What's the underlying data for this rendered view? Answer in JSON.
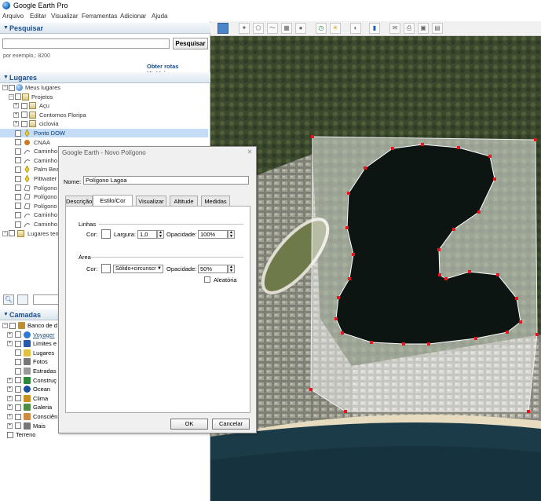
{
  "app": {
    "title": "Google Earth Pro"
  },
  "menu": [
    "Arquivo",
    "Editar",
    "Visualizar",
    "Ferramentas",
    "Adicionar",
    "Ajuda"
  ],
  "search": {
    "header": "Pesquisar",
    "input_value": "",
    "button": "Pesquisar",
    "hint": "por exemplo,: 8200",
    "links": [
      "Obter rotas",
      "Histórico"
    ]
  },
  "places": {
    "header": "Lugares",
    "items": [
      {
        "label": "Meus lugares"
      },
      {
        "label": "Projetos"
      },
      {
        "label": "Açu"
      },
      {
        "label": "Contornos Floripa"
      },
      {
        "label": "ciclovia"
      },
      {
        "label": "Ponto DOW"
      },
      {
        "label": "CNAA"
      },
      {
        "label": "Caminho"
      },
      {
        "label": "Caminho"
      },
      {
        "label": "Palm Bea"
      },
      {
        "label": "Pittwater"
      },
      {
        "label": "Polígono"
      },
      {
        "label": "Polígono"
      },
      {
        "label": "Polígono"
      },
      {
        "label": "Caminho"
      },
      {
        "label": "Caminho"
      },
      {
        "label": "Lugares ten"
      }
    ]
  },
  "layers": {
    "header": "Camadas",
    "items": [
      {
        "label": "Banco de d"
      },
      {
        "label": "Voyager"
      },
      {
        "label": "Limites e"
      },
      {
        "label": "Lugares"
      },
      {
        "label": "Fotos"
      },
      {
        "label": "Estradas"
      },
      {
        "label": "Construç"
      },
      {
        "label": "Ocean"
      },
      {
        "label": "Clima"
      },
      {
        "label": "Galeria"
      },
      {
        "label": "Consciên"
      },
      {
        "label": "Mais"
      },
      {
        "label": "Terreno"
      }
    ]
  },
  "dialog": {
    "title": "Google Earth - Novo Polígono",
    "name_label": "Nome:",
    "name_value": "Polígono Lagoa",
    "tabs": [
      "Descrição",
      "Estilo/Cor",
      "Visualizar",
      "Altitude",
      "Medidas"
    ],
    "lines": {
      "group": "Linhas",
      "color_label": "Cor:",
      "width_label": "Largura:",
      "width_value": "1,0",
      "opacity_label": "Opacidade:",
      "opacity_value": "100%"
    },
    "area": {
      "group": "Área",
      "color_label": "Cor:",
      "fill_value": "Sólido+circunscr",
      "opacity_label": "Opacidade:",
      "opacity_value": "50%",
      "random_label": "Aleatória"
    },
    "ok": "OK",
    "cancel": "Cancelar"
  },
  "colors": {
    "header_text": "#1b4f8c",
    "selection": "#c4dcf6",
    "polygon_vertex": "#e8141e",
    "polygon_fill": "#ffffff",
    "water": "#0c1512"
  }
}
